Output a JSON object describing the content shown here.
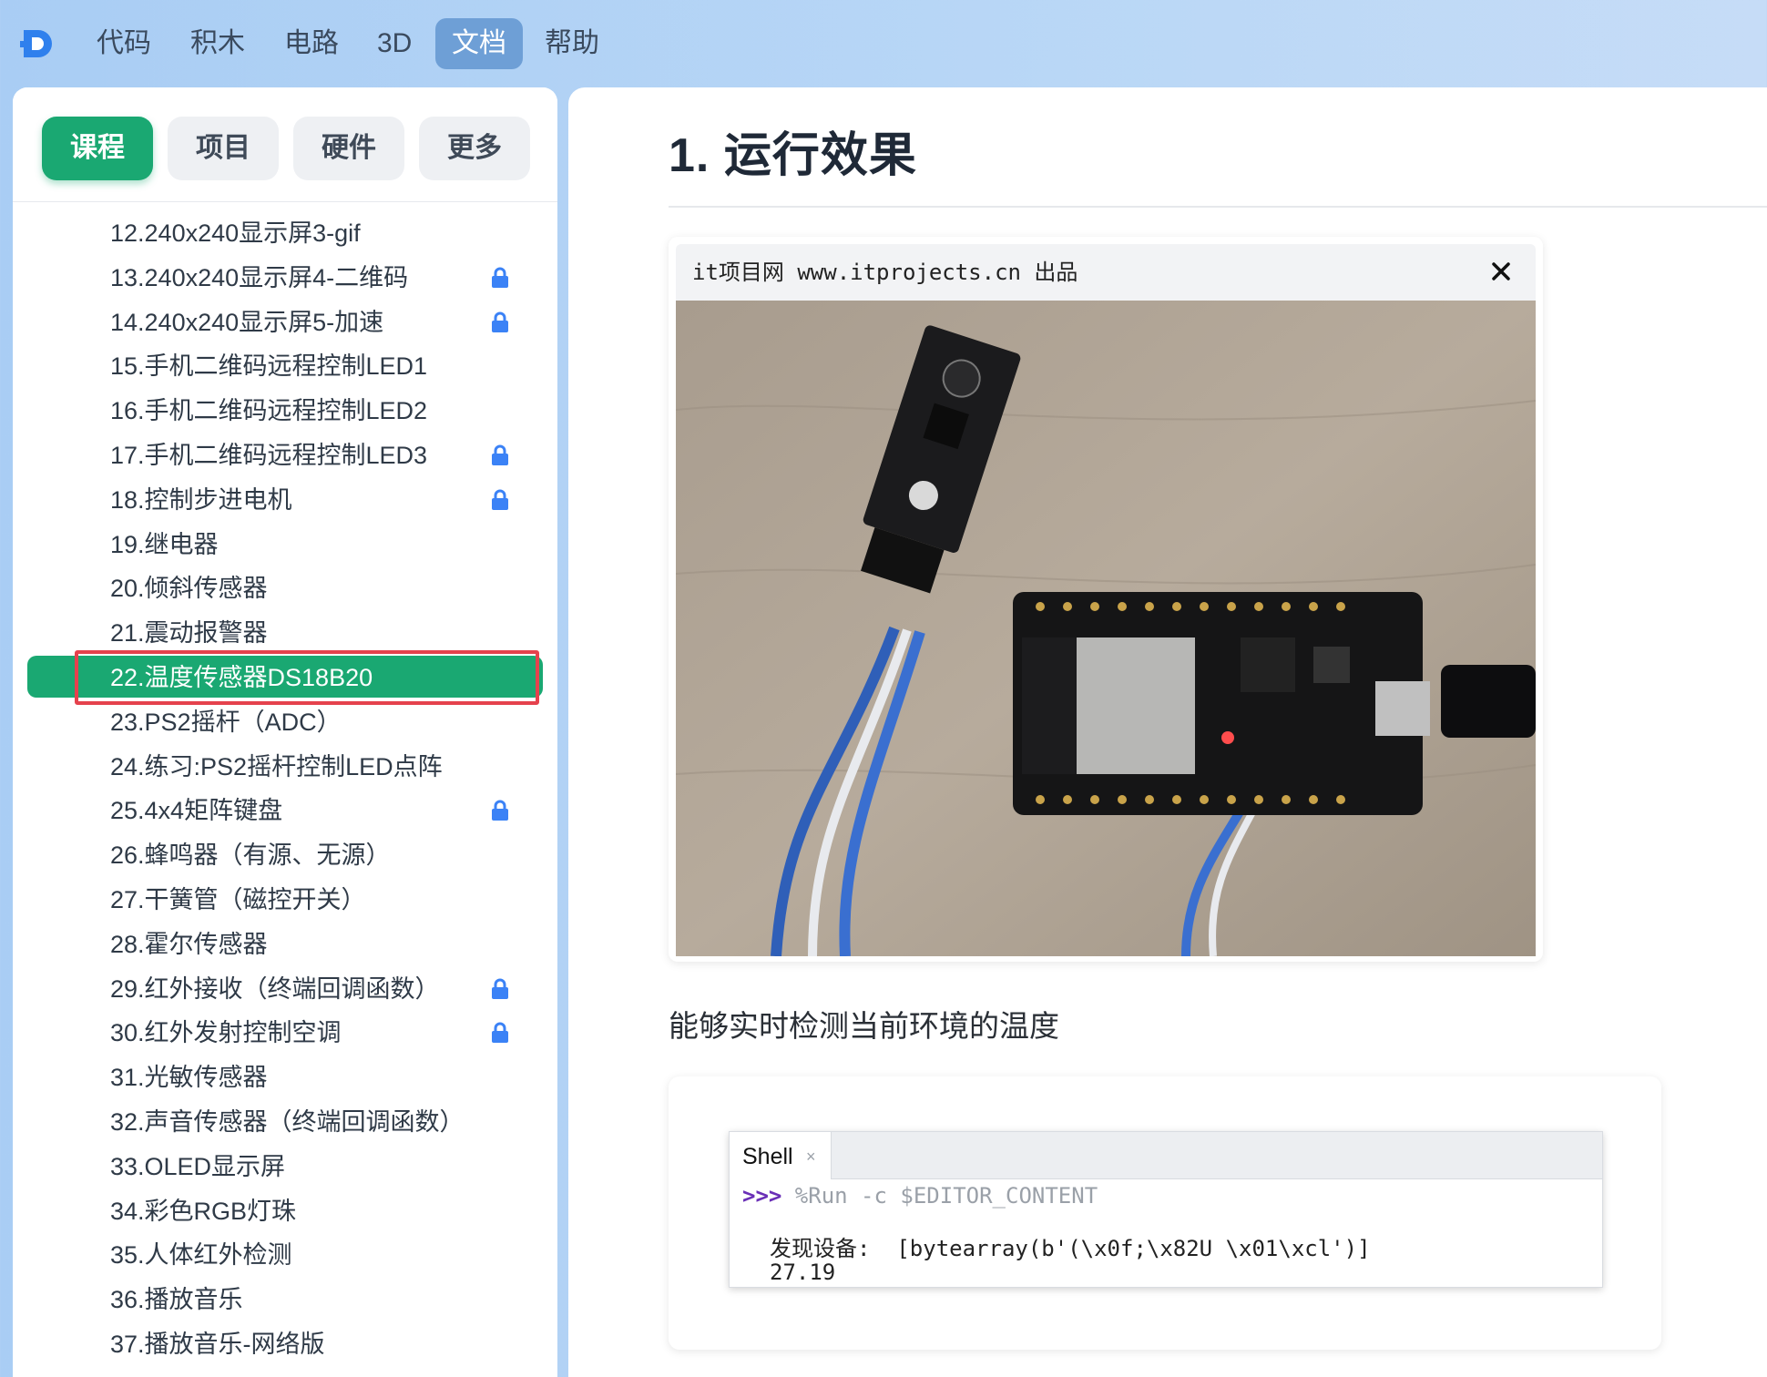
{
  "nav": {
    "items": [
      {
        "label": "代码"
      },
      {
        "label": "积木"
      },
      {
        "label": "电路"
      },
      {
        "label": "3D"
      },
      {
        "label": "文档",
        "active": true
      },
      {
        "label": "帮助"
      }
    ]
  },
  "sidebar": {
    "tabs": [
      {
        "label": "课程",
        "active": true
      },
      {
        "label": "项目"
      },
      {
        "label": "硬件"
      },
      {
        "label": "更多"
      }
    ],
    "courses": [
      {
        "label": "12.240x240显示屏3-gif",
        "locked": false
      },
      {
        "label": "13.240x240显示屏4-二维码",
        "locked": true
      },
      {
        "label": "14.240x240显示屏5-加速",
        "locked": true
      },
      {
        "label": "15.手机二维码远程控制LED1",
        "locked": false
      },
      {
        "label": "16.手机二维码远程控制LED2",
        "locked": false
      },
      {
        "label": "17.手机二维码远程控制LED3",
        "locked": true
      },
      {
        "label": "18.控制步进电机",
        "locked": true
      },
      {
        "label": "19.继电器",
        "locked": false
      },
      {
        "label": "20.倾斜传感器",
        "locked": false
      },
      {
        "label": "21.震动报警器",
        "locked": false
      },
      {
        "label": "22.温度传感器DS18B20",
        "locked": false,
        "active": true
      },
      {
        "label": "23.PS2摇杆（ADC）",
        "locked": false
      },
      {
        "label": "24.练习:PS2摇杆控制LED点阵",
        "locked": false
      },
      {
        "label": "25.4x4矩阵键盘",
        "locked": true
      },
      {
        "label": "26.蜂鸣器（有源、无源）",
        "locked": false
      },
      {
        "label": "27.干簧管（磁控开关）",
        "locked": false
      },
      {
        "label": "28.霍尔传感器",
        "locked": false
      },
      {
        "label": "29.红外接收（终端回调函数）",
        "locked": true
      },
      {
        "label": "30.红外发射控制空调",
        "locked": true
      },
      {
        "label": "31.光敏传感器",
        "locked": false
      },
      {
        "label": "32.声音传感器（终端回调函数）",
        "locked": false
      },
      {
        "label": "33.OLED显示屏",
        "locked": false
      },
      {
        "label": "34.彩色RGB灯珠",
        "locked": false
      },
      {
        "label": "35.人体红外检测",
        "locked": false
      },
      {
        "label": "36.播放音乐",
        "locked": false
      },
      {
        "label": "37.播放音乐-网络版",
        "locked": false
      }
    ]
  },
  "main": {
    "title": "1. 运行效果",
    "image_caption": "it项目网 www.itprojects.cn 出品",
    "description": "能够实时检测当前环境的温度",
    "shell": {
      "tab": "Shell",
      "tab_close": "×",
      "prompt": ">>>",
      "command": " %Run -c $EDITOR_CONTENT",
      "output_label": "发现设备:",
      "output_value": "  [bytearray(b'(\\x0f;\\x82U \\x01\\xcl')]",
      "temperature": "27.19"
    }
  },
  "colors": {
    "accent_green": "#1aa872",
    "nav_active": "#6e9fd6",
    "lock_blue": "#3b82f6",
    "highlight_red": "#e5424d"
  },
  "icons": {
    "logo": "d-logo-icon",
    "lock": "lock-icon",
    "close": "close-icon"
  }
}
